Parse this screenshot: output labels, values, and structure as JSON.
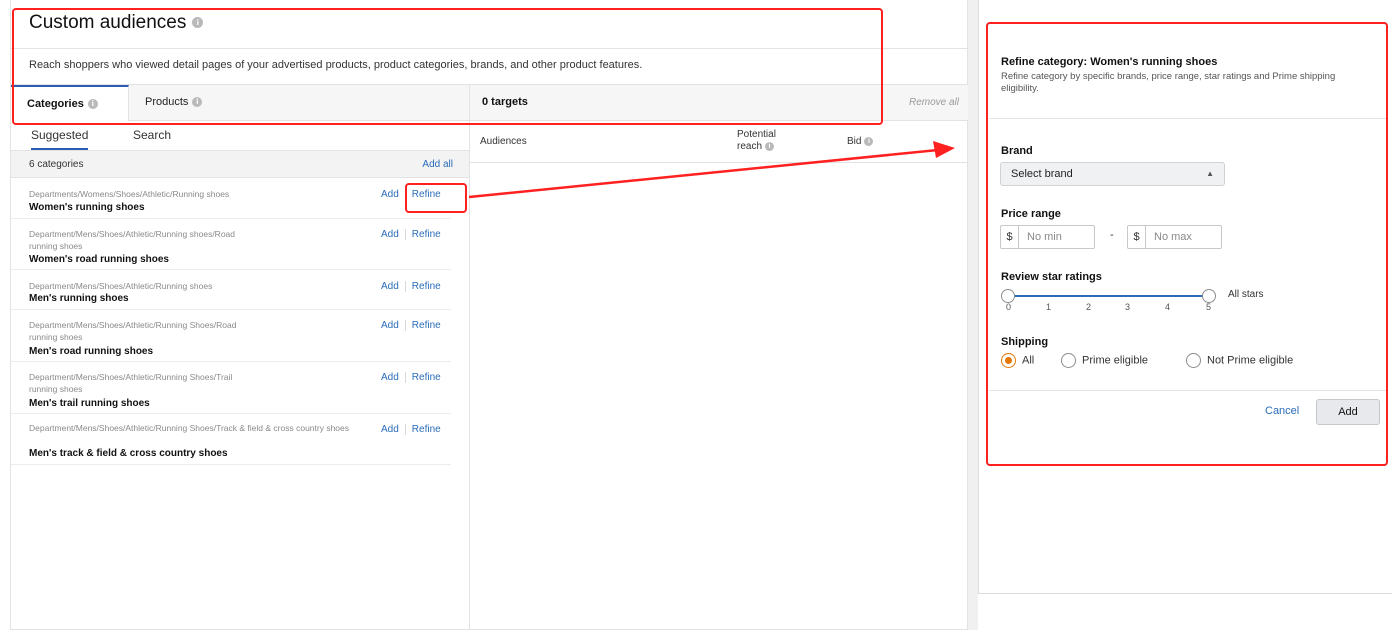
{
  "header": {
    "title": "Custom audiences",
    "description": "Reach shoppers who viewed detail pages of your advertised products, product categories, brands, and other product features."
  },
  "tabs": {
    "categories": "Categories",
    "products": "Products"
  },
  "subtabs": {
    "suggested": "Suggested",
    "search": "Search"
  },
  "categories": {
    "count": "6 categories",
    "add_all": "Add all",
    "add_label": "Add",
    "refine_label": "Refine",
    "items": [
      {
        "path": "Departments/Womens/Shoes/Athletic/Running shoes",
        "name": "Women's running shoes"
      },
      {
        "path": "Department/Mens/Shoes/Athletic/Running shoes/Road running shoes",
        "name": "Women's road running shoes"
      },
      {
        "path": "Department/Mens/Shoes/Athletic/Running shoes",
        "name": "Men's running shoes"
      },
      {
        "path": "Department/Mens/Shoes/Athletic/Running Shoes/Road running shoes",
        "name": "Men's road running shoes"
      },
      {
        "path": "Department/Mens/Shoes/Athletic/Running Shoes/Trail running shoes",
        "name": "Men's trail running shoes"
      },
      {
        "path": "Department/Mens/Shoes/Athletic/Running Shoes/Track & field & cross country shoes",
        "name": "Men's track & field & cross country shoes"
      }
    ]
  },
  "targets": {
    "count": "0 targets",
    "remove_all": "Remove all",
    "columns": {
      "audiences": "Audiences",
      "potential_reach": "Potential reach",
      "bid": "Bid"
    }
  },
  "refine": {
    "title": "Refine category: Women's running shoes",
    "description": "Refine category by specific brands, price range, star ratings and Prime shipping eligibility.",
    "brand_label": "Brand",
    "brand_select": "Select brand",
    "price_label": "Price range",
    "currency": "$",
    "min_placeholder": "No min",
    "max_placeholder": "No max",
    "price_sep": "-",
    "rating_label": "Review star ratings",
    "rating_ticks": [
      "0",
      "1",
      "2",
      "3",
      "4",
      "5"
    ],
    "rating_range": [
      0,
      5
    ],
    "rating_value_text": "All stars",
    "shipping_label": "Shipping",
    "shipping_options": [
      "All",
      "Prime eligible",
      "Not Prime eligible"
    ],
    "shipping_selected": "All",
    "cancel": "Cancel",
    "add": "Add"
  },
  "colors": {
    "accent": "#2a6cb8",
    "annotation": "#ff2020",
    "radio_selected": "#e77600"
  }
}
